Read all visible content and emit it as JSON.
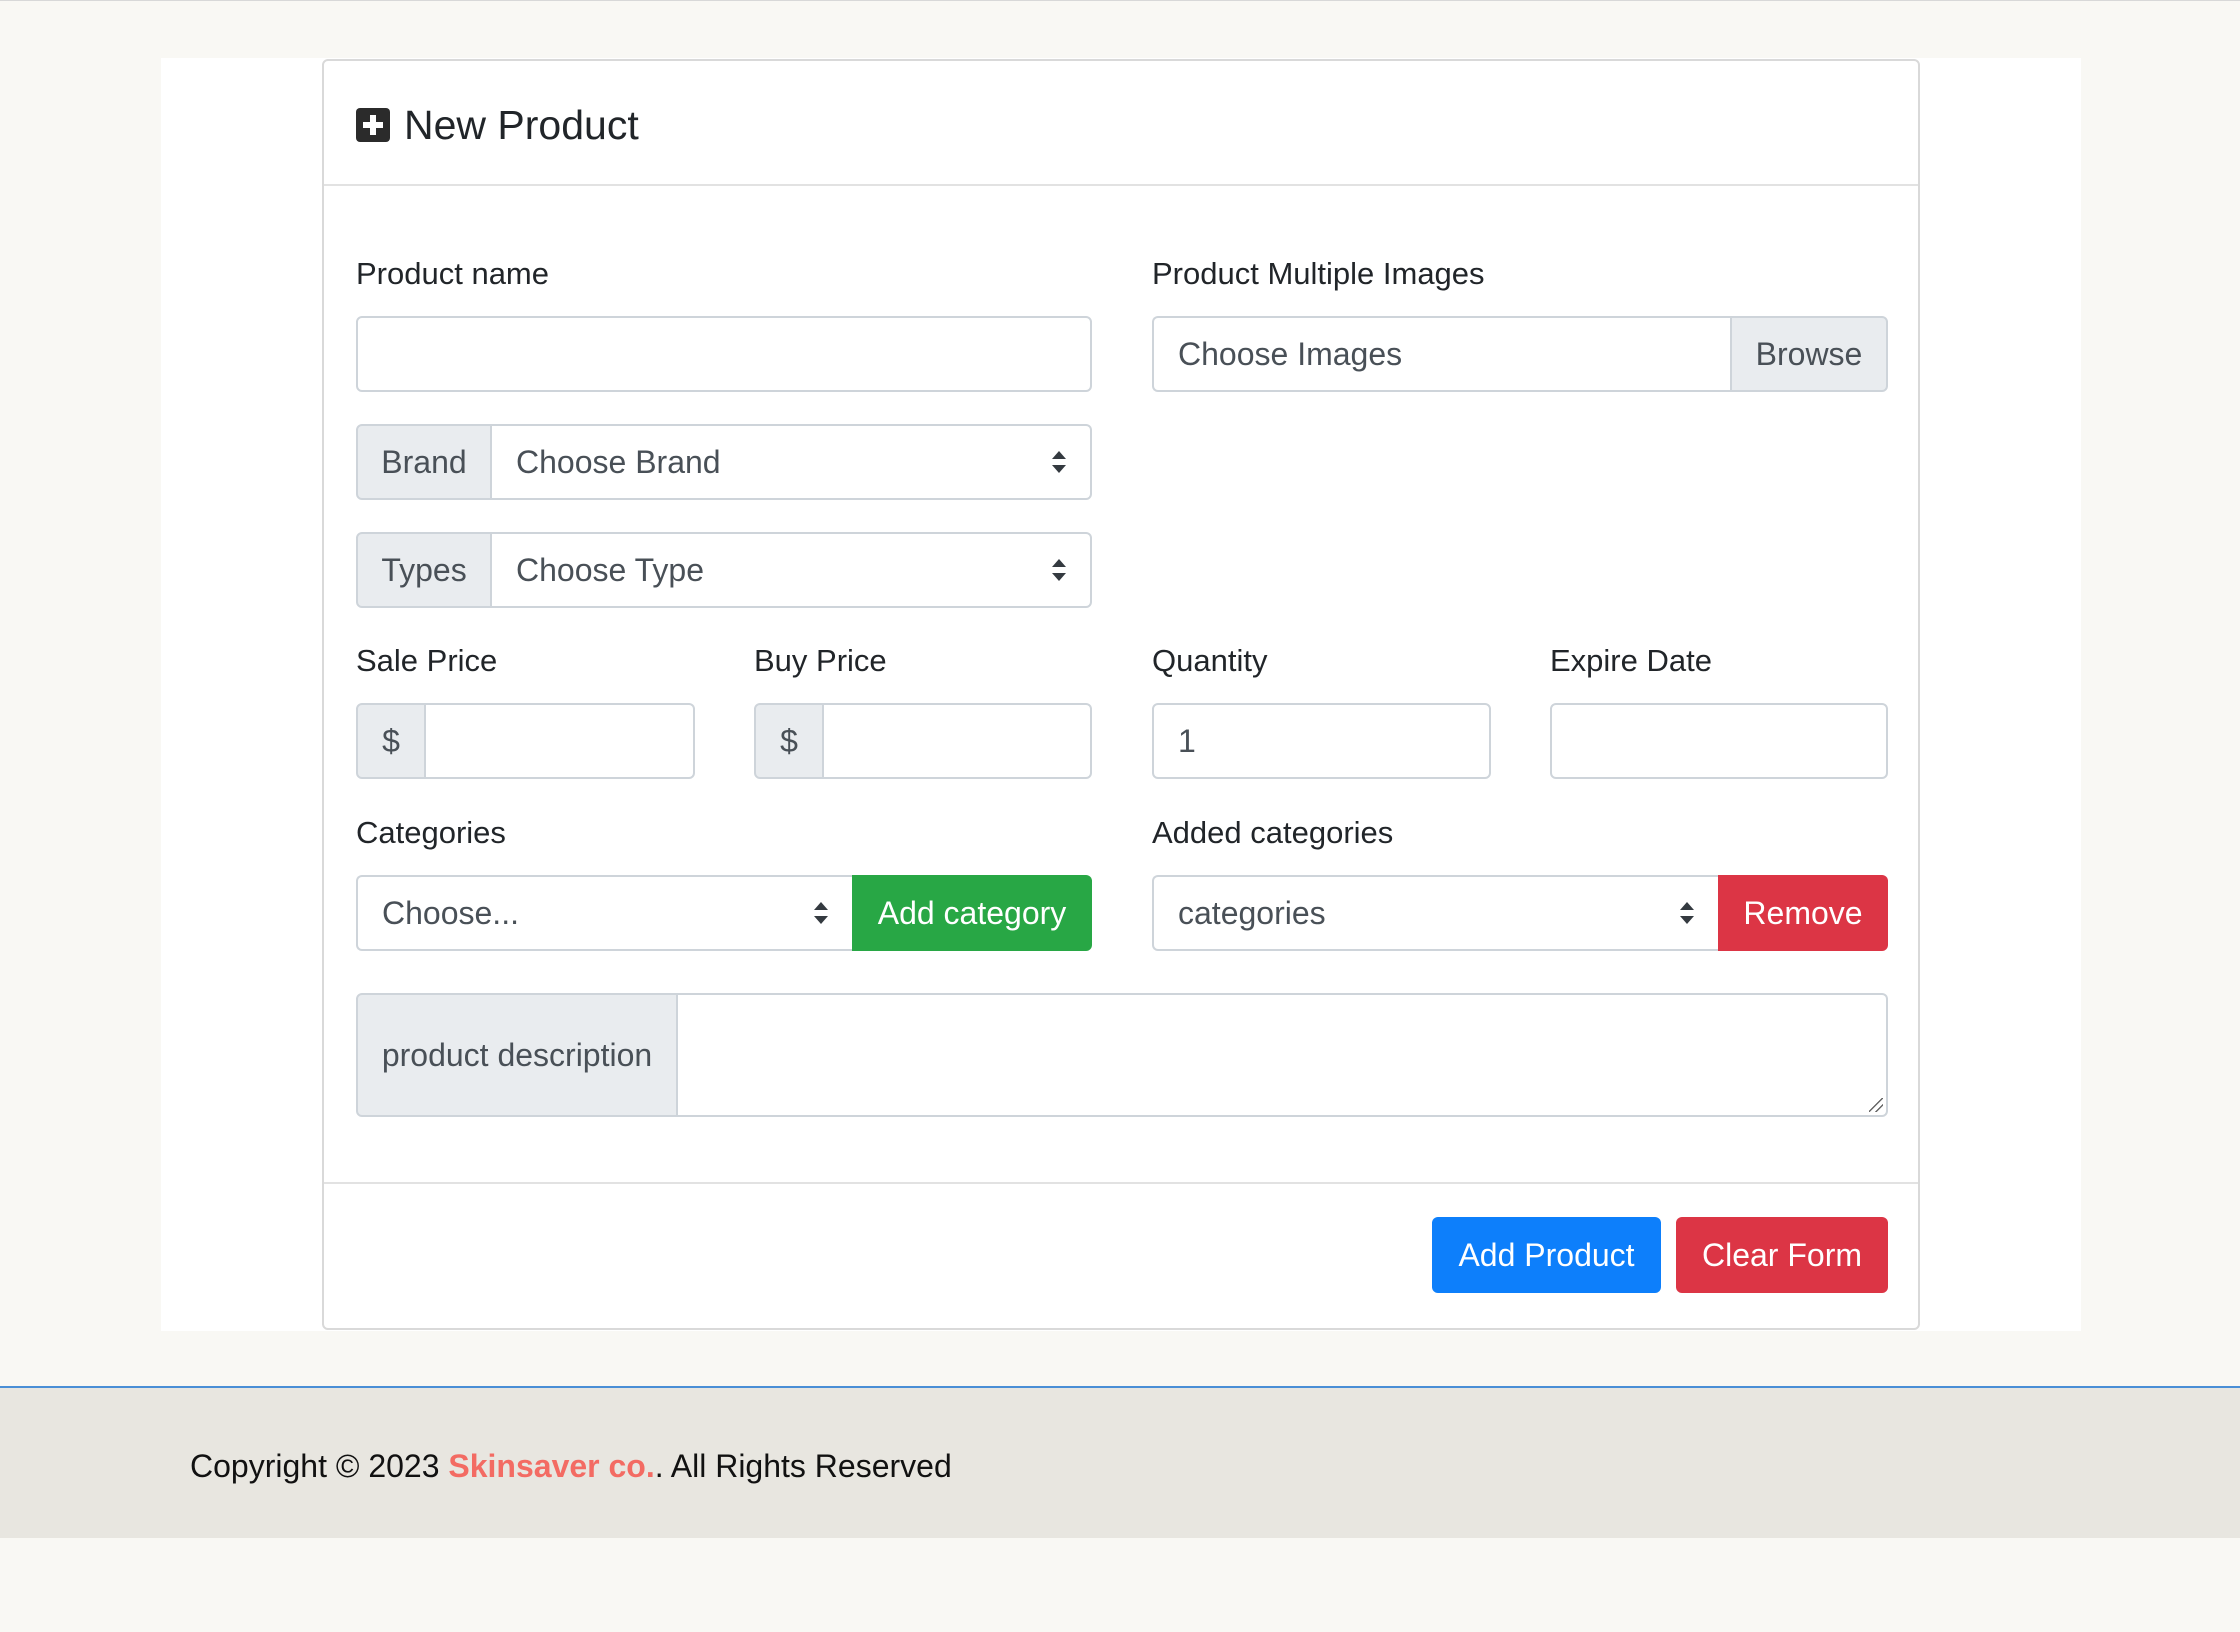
{
  "card": {
    "title": "New Product"
  },
  "form": {
    "product_name": {
      "label": "Product name",
      "value": ""
    },
    "images": {
      "label": "Product Multiple Images",
      "placeholder": "Choose Images",
      "browse": "Browse"
    },
    "brand": {
      "addon": "Brand",
      "selected": "Choose Brand"
    },
    "types": {
      "addon": "Types",
      "selected": "Choose Type"
    },
    "sale_price": {
      "label": "Sale Price",
      "prefix": "$",
      "value": ""
    },
    "buy_price": {
      "label": "Buy Price",
      "prefix": "$",
      "value": ""
    },
    "quantity": {
      "label": "Quantity",
      "value": "1"
    },
    "expire_date": {
      "label": "Expire Date",
      "value": ""
    },
    "categories": {
      "label": "Categories",
      "selected": "Choose...",
      "add_button": "Add category"
    },
    "added_categories": {
      "label": "Added categories",
      "selected": "categories",
      "remove_button": "Remove"
    },
    "description": {
      "addon": "product description",
      "value": ""
    }
  },
  "actions": {
    "add_product": "Add Product",
    "clear_form": "Clear Form"
  },
  "footer": {
    "prefix": "Copyright © 2023 ",
    "brand": "Skinsaver co.",
    "suffix": ". All Rights Reserved"
  },
  "colors": {
    "primary": "#0d7ffb",
    "success": "#28a745",
    "danger": "#dc3545",
    "brand_link": "#f36b63"
  }
}
